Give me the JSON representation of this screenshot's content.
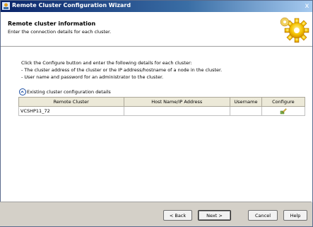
{
  "window": {
    "title": "Remote Cluster Configuration Wizard",
    "close_symbol": "x"
  },
  "header": {
    "title": "Remote cluster information",
    "subtitle": "Enter the connection details for each cluster."
  },
  "instructions": [
    "Click the Configure button and enter the following details for each cluster:",
    "- The cluster address of the cluster or the IP address/hostname of a node in the cluster.",
    "- User name and password for an administrator to the cluster."
  ],
  "section": {
    "label": "Existing cluster configuration details"
  },
  "table": {
    "columns": [
      "Remote Cluster",
      "Host Name/IP Address",
      "Username",
      "Configure"
    ],
    "rows": [
      {
        "remote_cluster": "VCSHP11_72",
        "host": "",
        "username": ""
      }
    ]
  },
  "buttons": {
    "back": "< Back",
    "next": "Next >",
    "cancel": "Cancel",
    "help": "Help"
  },
  "colors": {
    "titlebar": "#0a246a",
    "accent_gear": "#f5b800"
  }
}
